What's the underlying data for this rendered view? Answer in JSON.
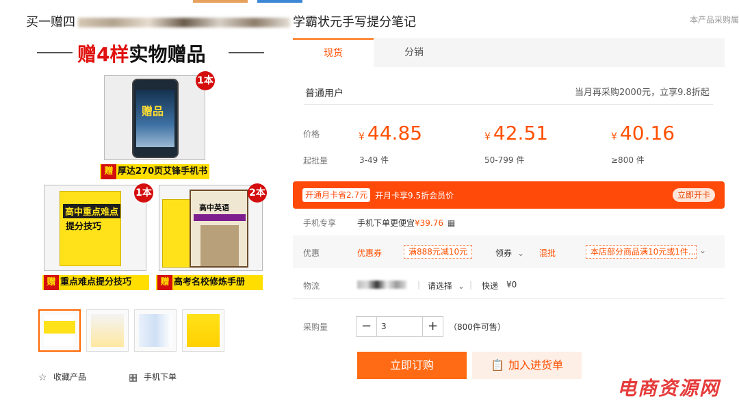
{
  "title": {
    "prefix": "买一赠四",
    "suffix": "学霸状元手写提分笔记"
  },
  "right_note": "本产品采购属",
  "promo": {
    "headline_prefix": "赠",
    "headline_red": "4样",
    "headline_suffix": "实物赠品",
    "phone_cover": "赠品",
    "ribbon1": "厚达270页艾锋手机书",
    "ribbon2": "重点难点提分技巧",
    "ribbon3": "高考名校修炼手册",
    "zeng": "赠",
    "badge1": "1本",
    "badge2": "1本",
    "badge3": "2本",
    "book1_title": "高中重点难点",
    "book1_sub": "提分技巧",
    "book2_title": "高中英语"
  },
  "actions": {
    "favorite": "收藏产品",
    "mobile_order": "手机下单"
  },
  "tabs": [
    {
      "label": "现货"
    },
    {
      "label": "分销"
    }
  ],
  "user_type": "普通用户",
  "discount_note": "当月再采购2000元，立享9.8折起",
  "labels": {
    "price": "价格",
    "min_batch": "起批量"
  },
  "tiers": [
    {
      "currency": "¥",
      "price": "44.85",
      "range": "3-49 件"
    },
    {
      "currency": "¥",
      "price": "42.51",
      "range": "50-799 件"
    },
    {
      "currency": "¥",
      "price": "40.16",
      "range": "≥800 件"
    }
  ],
  "vip": {
    "chip": "开通月卡省2.7元",
    "text": "开月卡享9.5折会员价",
    "button": "立即开卡"
  },
  "mobile": {
    "label": "手机专享",
    "text": "手机下单更便宜",
    "price": "¥39.76"
  },
  "youhui": {
    "label": "优惠",
    "coupon_label": "优惠券",
    "coupon": "满888元减10元",
    "get": "领券",
    "mix_label": "混批",
    "mix": "本店部分商品满10元或1件..."
  },
  "logistics": {
    "label": "物流",
    "select": "请选择",
    "express": "快递",
    "fee": "¥0"
  },
  "quantity": {
    "label": "采购量",
    "minus": "−",
    "value": "3",
    "plus": "+",
    "stock": "（800件可售）"
  },
  "buttons": {
    "buy": "立即订购",
    "cart": "加入进货单"
  },
  "watermark": "电商资源网",
  "colors": {
    "accent": "#ff5000",
    "vip_bar": "#ff4a0a",
    "buy_button": "#ff6a14"
  }
}
